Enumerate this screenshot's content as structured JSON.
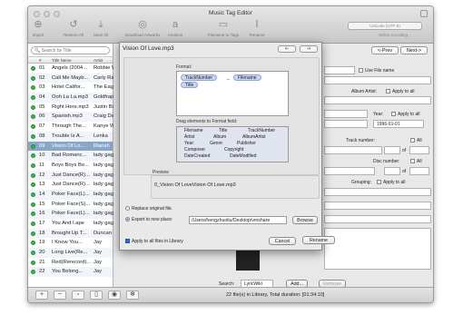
{
  "window": {
    "title": "Music Tag Editor"
  },
  "toolbar": {
    "items": [
      {
        "label": "Import",
        "icon": "plus-icon"
      },
      {
        "label": "Restore All",
        "icon": "restore-icon"
      },
      {
        "label": "Save All",
        "icon": "save-icon"
      },
      {
        "label": "Download Artworks",
        "icon": "download-icon"
      },
      {
        "label": "Amazon",
        "icon": "amazon-icon"
      },
      {
        "label": "Filename to Tags",
        "icon": "filename-tags-icon"
      },
      {
        "label": "Rename",
        "icon": "rename-icon"
      }
    ],
    "encoding_value": "Unicode (UTF-8)",
    "encoding_label": "Select encoding"
  },
  "sidebar": {
    "search_placeholder": "Search by Title",
    "col_num": "#",
    "col_title": "Title Name",
    "col_artist": "Artist",
    "rows": [
      {
        "num": "01",
        "name": "Angels (2004...",
        "artist": "Robbie W"
      },
      {
        "num": "02",
        "name": "Call Me Mayb...",
        "artist": "Carly Ra"
      },
      {
        "num": "03",
        "name": "Hotel Califor...",
        "artist": "The Eag"
      },
      {
        "num": "04",
        "name": "Ooh La La.mp3",
        "artist": "Goldfrap"
      },
      {
        "num": "05",
        "name": "Right Here.mp3",
        "artist": "Justin Bi"
      },
      {
        "num": "06",
        "name": "Spanish.mp3",
        "artist": "Craig Da"
      },
      {
        "num": "07",
        "name": "Through The...",
        "artist": "Kanye W"
      },
      {
        "num": "08",
        "name": "Trouble Is A...",
        "artist": "Lenka"
      },
      {
        "num": "09",
        "name": "Vision Of Lo...",
        "artist": "Mariah"
      },
      {
        "num": "10",
        "name": "Bad Romanc...",
        "artist": "lady gag"
      },
      {
        "num": "11",
        "name": "Boys Boys Bo...",
        "artist": "lady gag"
      },
      {
        "num": "12",
        "name": "Just Dance(R)...",
        "artist": "lady gag"
      },
      {
        "num": "13",
        "name": "Just Dance(R)...",
        "artist": "lady gag"
      },
      {
        "num": "14",
        "name": "Poker Face(L)...",
        "artist": "lady gag"
      },
      {
        "num": "15",
        "name": "Poker Face(S)...",
        "artist": "lady gag"
      },
      {
        "num": "16",
        "name": "Poker Face(L)...",
        "artist": "lady gag"
      },
      {
        "num": "17",
        "name": "You And I.ape",
        "artist": "lady gag"
      },
      {
        "num": "18",
        "name": "Brought Up T...",
        "artist": "Duncan"
      },
      {
        "num": "19",
        "name": "I Know You...",
        "artist": "Jay"
      },
      {
        "num": "20",
        "name": "Long Live(Re...",
        "artist": "Jay"
      },
      {
        "num": "21",
        "name": "Red(Rerecord)...",
        "artist": "Jay"
      },
      {
        "num": "22",
        "name": "You Belong...",
        "artist": "Jay"
      }
    ],
    "selected_index": 8
  },
  "bottom": {
    "status": "22 file(s) in Library, Total duration: [01:34:10]"
  },
  "editor": {
    "prev": "<-Prev",
    "next": "Next->",
    "use_file_name": "Use File name",
    "album_artist": "Album Artist:",
    "apply_to_all": "Apply to all",
    "year_label": "Year:",
    "year_value": "1996-01-01",
    "track_number": "Track number:",
    "all": "All",
    "of": "of",
    "disc_number": "Disc number:",
    "grouping": "Grouping:",
    "search_label": "Search:",
    "search_engine": "LyricWiki",
    "add": "Add...",
    "remove": "Remove"
  },
  "dialog": {
    "filename": "Vision Of Love.mp3",
    "back": "<-",
    "forward": "->",
    "format_label": "Format:",
    "format_tokens": [
      "TrackNumber",
      "_",
      "Filename",
      "Title"
    ],
    "drag_label": "Drag elements to Format field:",
    "elements": [
      "Filename",
      "Title",
      "TrackNumber",
      "Artist",
      "Album",
      "AlbumArtist",
      "Year",
      "Genre",
      "Publisher",
      "Composer",
      "Copyright",
      "DateCreated",
      "DateModified"
    ],
    "preview_label": "Preview",
    "preview_value": "0_Vision Of LoveVision Of Love.mp3",
    "replace_label": "Replace original file.",
    "export_label": "Export to new place:",
    "export_path": "/Users/hengzhuoliu/Desktop/vmshare",
    "browse": "Browse",
    "apply_all": "Apply to all files in Library",
    "cancel": "Cancel",
    "rename": "Rename"
  }
}
